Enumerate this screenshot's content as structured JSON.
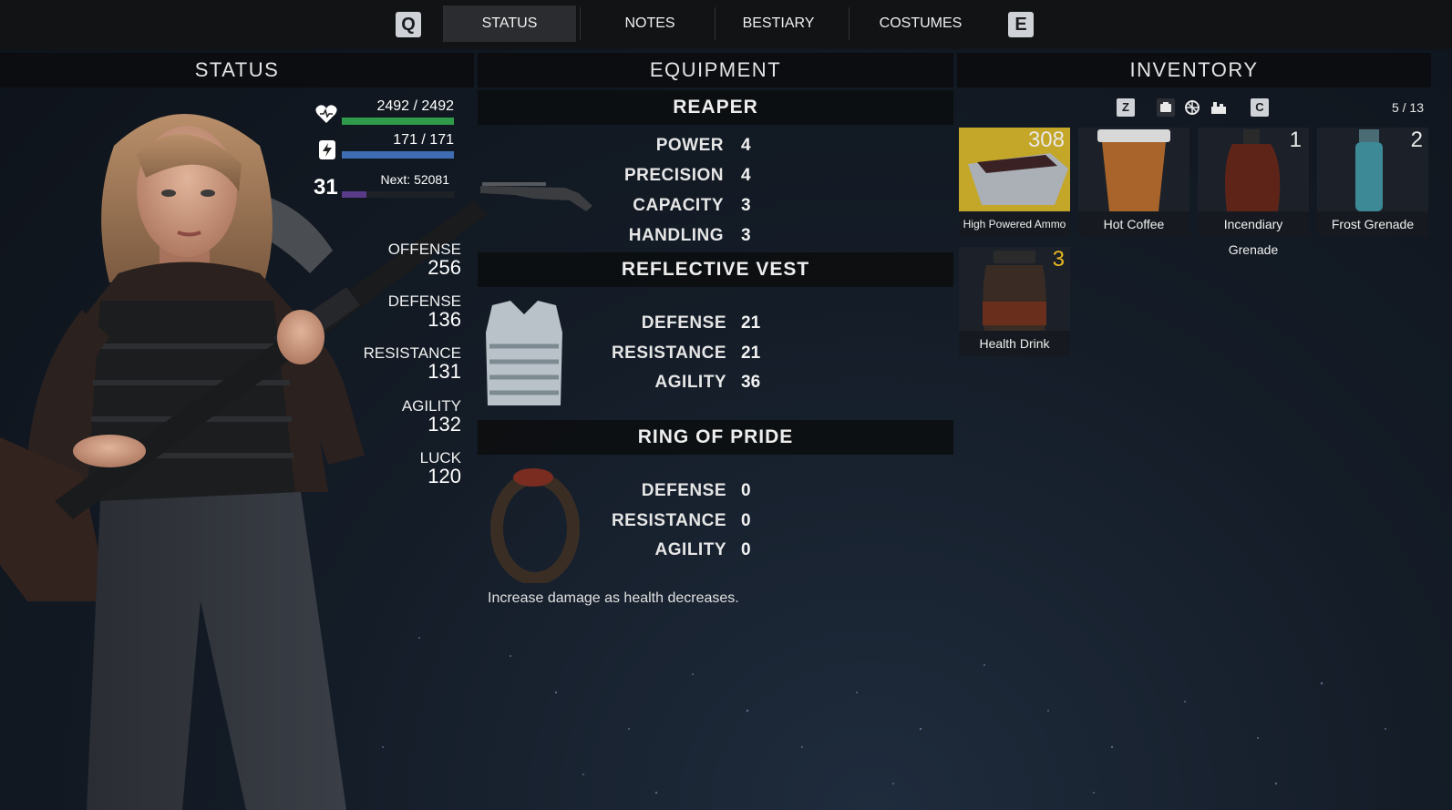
{
  "nav": {
    "left_key": "Q",
    "right_key": "E",
    "tabs": [
      "STATUS",
      "NOTES",
      "BESTIARY",
      "COSTUMES"
    ],
    "active_tab": "STATUS"
  },
  "columns": {
    "status": "STATUS",
    "equipment": "EQUIPMENT",
    "inventory": "INVENTORY"
  },
  "status": {
    "health": {
      "text": "2492 / 2492",
      "fraction": 1.0,
      "color": "#2e9a4a"
    },
    "stamina": {
      "text": "171 / 171",
      "fraction": 1.0,
      "color": "#3e6db3"
    },
    "level": "31",
    "next": "Next: 52081",
    "xp_fraction": 0.22,
    "xp_color": "#5a3b8a",
    "stats": [
      {
        "label": "OFFENSE",
        "value": "256"
      },
      {
        "label": "DEFENSE",
        "value": "136"
      },
      {
        "label": "RESISTANCE",
        "value": "131"
      },
      {
        "label": "AGILITY",
        "value": "132"
      },
      {
        "label": "LUCK",
        "value": "120"
      }
    ]
  },
  "equipment": {
    "weapon": {
      "name": "REAPER",
      "stats": [
        {
          "label": "POWER",
          "value": "4"
        },
        {
          "label": "PRECISION",
          "value": "4"
        },
        {
          "label": "CAPACITY",
          "value": "3"
        },
        {
          "label": "HANDLING",
          "value": "3"
        }
      ]
    },
    "armor": {
      "name": "REFLECTIVE VEST",
      "stats": [
        {
          "label": "DEFENSE",
          "value": "21"
        },
        {
          "label": "RESISTANCE",
          "value": "21"
        },
        {
          "label": "AGILITY",
          "value": "36"
        }
      ]
    },
    "accessory": {
      "name": "RING OF PRIDE",
      "stats": [
        {
          "label": "DEFENSE",
          "value": "0"
        },
        {
          "label": "RESISTANCE",
          "value": "0"
        },
        {
          "label": "AGILITY",
          "value": "0"
        }
      ],
      "description": "Increase damage as health decreases."
    }
  },
  "inventory": {
    "prev_key": "Z",
    "next_key": "C",
    "count": "5 / 13",
    "items": [
      {
        "name": "High Powered Ammo",
        "qty": "308",
        "icon": "ammo-crate-icon"
      },
      {
        "name": "Hot Coffee",
        "qty": "",
        "icon": "coffee-cup-icon"
      },
      {
        "name": "Incendiary Grenade",
        "qty": "1",
        "icon": "incendiary-grenade-icon"
      },
      {
        "name": "Frost Grenade",
        "qty": "2",
        "icon": "frost-grenade-icon"
      },
      {
        "name": "Health Drink",
        "qty": "3",
        "icon": "health-drink-icon",
        "qty_color": "#e8b820"
      }
    ]
  }
}
